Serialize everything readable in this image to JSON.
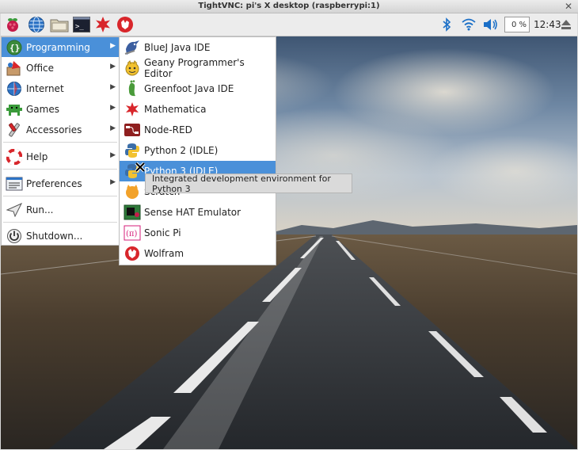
{
  "window": {
    "title": "TightVNC: pi's X desktop (raspberrypi:1)"
  },
  "panel": {
    "launchers": [
      "raspberry-menu-icon",
      "web-browser-icon",
      "file-manager-icon",
      "terminal-icon",
      "mathematica-icon",
      "wolfram-icon"
    ],
    "tray": [
      "bluetooth-icon",
      "wifi-icon",
      "volume-icon"
    ],
    "cpu": "0 %",
    "clock": "12:43"
  },
  "menu": {
    "items": [
      {
        "label": "Programming",
        "icon": "programming-icon",
        "submenu": true,
        "active": true
      },
      {
        "label": "Office",
        "icon": "office-icon",
        "submenu": true
      },
      {
        "label": "Internet",
        "icon": "internet-icon",
        "submenu": true
      },
      {
        "label": "Games",
        "icon": "games-icon",
        "submenu": true
      },
      {
        "label": "Accessories",
        "icon": "accessories-icon",
        "submenu": true
      },
      {
        "label": "Help",
        "icon": "help-icon",
        "submenu": true
      },
      {
        "label": "Preferences",
        "icon": "preferences-icon",
        "submenu": true
      },
      {
        "label": "Run...",
        "icon": "run-icon",
        "submenu": false
      },
      {
        "label": "Shutdown...",
        "icon": "shutdown-icon",
        "submenu": false
      }
    ]
  },
  "submenu": {
    "items": [
      {
        "label": "BlueJ Java IDE",
        "icon": "bluej-icon"
      },
      {
        "label": "Geany Programmer's Editor",
        "icon": "geany-icon"
      },
      {
        "label": "Greenfoot Java IDE",
        "icon": "greenfoot-icon"
      },
      {
        "label": "Mathematica",
        "icon": "mathematica-icon"
      },
      {
        "label": "Node-RED",
        "icon": "node-red-icon"
      },
      {
        "label": "Python 2 (IDLE)",
        "icon": "python-icon"
      },
      {
        "label": "Python 3 (IDLE)",
        "icon": "python-icon",
        "active": true
      },
      {
        "label": "Scratch",
        "icon": "scratch-icon"
      },
      {
        "label": "Sense HAT Emulator",
        "icon": "sense-hat-icon"
      },
      {
        "label": "Sonic Pi",
        "icon": "sonic-pi-icon"
      },
      {
        "label": "Wolfram",
        "icon": "wolfram-icon"
      }
    ]
  },
  "tooltip": {
    "text": "Integrated development environment for Python 3"
  },
  "colors": {
    "accent": "#4a90d9",
    "panel": "#ececec"
  }
}
